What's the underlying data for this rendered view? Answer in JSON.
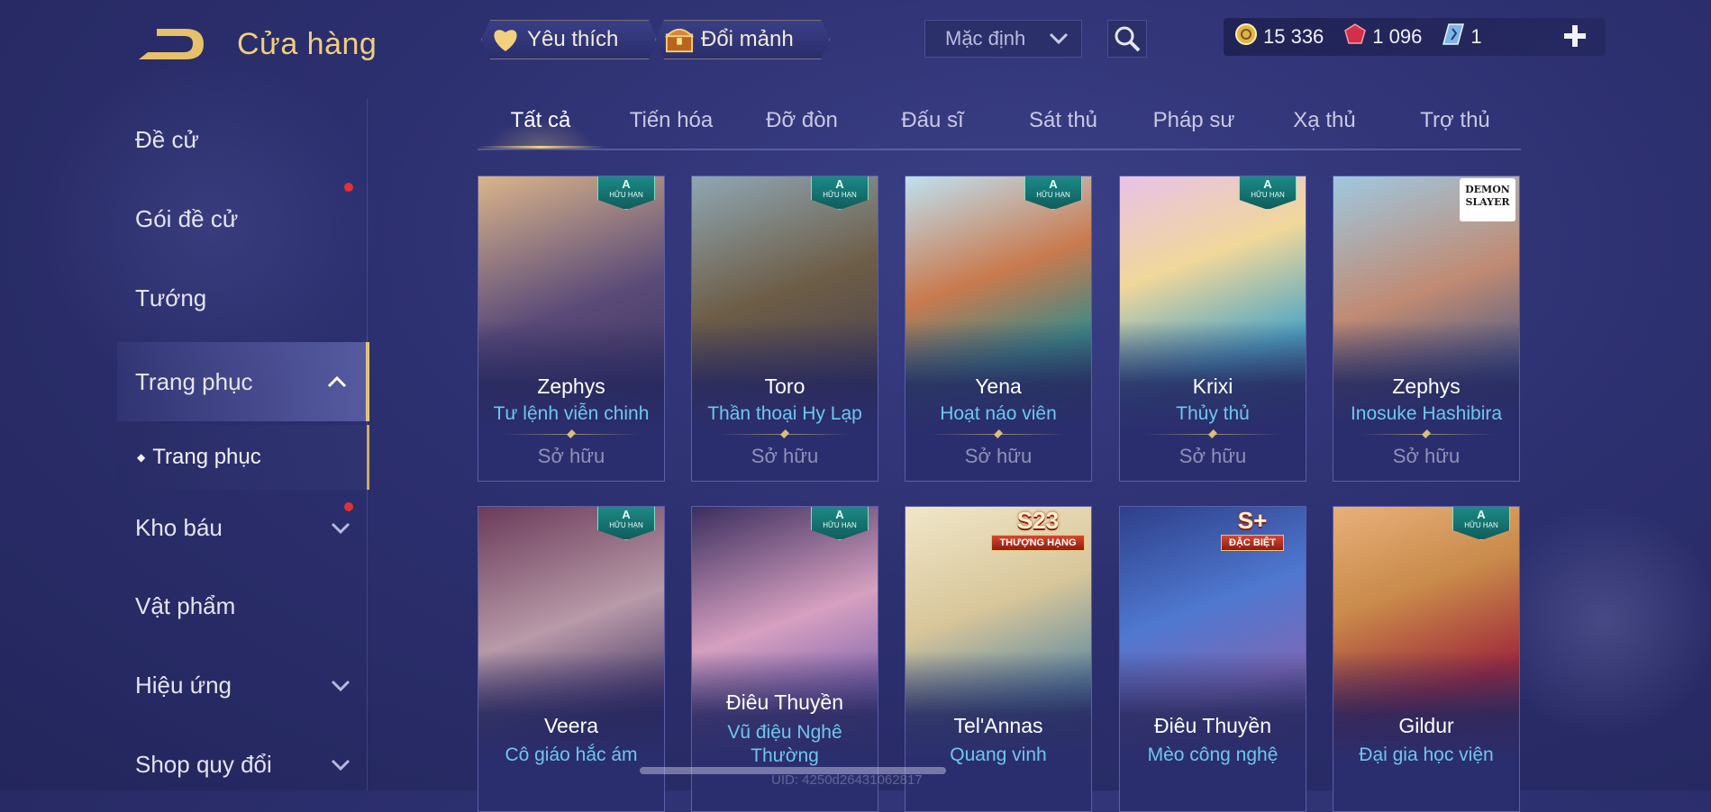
{
  "header": {
    "title": "Cửa hàng",
    "favorite_label": "Yêu thích",
    "exchange_label": "Đổi mảnh",
    "sort_select_value": "Mặc định"
  },
  "currency": {
    "gold": "15 336",
    "rubies": "1 096",
    "vouchers": "1"
  },
  "sidebar": {
    "items": [
      {
        "label": "Đề cử"
      },
      {
        "label": "Gói đề cử"
      },
      {
        "label": "Tướng"
      },
      {
        "label": "Trang phục"
      },
      {
        "label": "Kho báu"
      },
      {
        "label": "Vật phẩm"
      },
      {
        "label": "Hiệu ứng"
      },
      {
        "label": "Shop quy đổi"
      }
    ],
    "sub_item": "Trang phục"
  },
  "tabs": [
    "Tất cả",
    "Tiến hóa",
    "Đỡ đòn",
    "Đấu sĩ",
    "Sát thủ",
    "Pháp sư",
    "Xạ thủ",
    "Trợ thủ"
  ],
  "cards": [
    {
      "hero": "Zephys",
      "skin": "Tư lệnh viễn chinh",
      "status": "Sở hữu",
      "tag": "A",
      "tag_sub": "HỮU HẠN"
    },
    {
      "hero": "Toro",
      "skin": "Thần thoại Hy Lạp",
      "status": "Sở hữu",
      "tag": "A",
      "tag_sub": "HỮU HẠN"
    },
    {
      "hero": "Yena",
      "skin": "Hoạt náo viên",
      "status": "Sở hữu",
      "tag": "A",
      "tag_sub": "HỮU HẠN"
    },
    {
      "hero": "Krixi",
      "skin": "Thủy thủ",
      "status": "Sở hữu",
      "tag": "A",
      "tag_sub": "HỮU HẠN"
    },
    {
      "hero": "Zephys",
      "skin": "Inosuke Hashibira",
      "status": "Sở hữu",
      "tag": "DEMON SLAYER",
      "tag_sub": ""
    },
    {
      "hero": "Veera",
      "skin": "Cô giáo hắc ám",
      "status": "",
      "tag": "A",
      "tag_sub": "HỮU HẠN"
    },
    {
      "hero": "Điêu Thuyền",
      "skin": "Vũ điệu Nghê Thường",
      "status": "",
      "tag": "A",
      "tag_sub": "HỮU HẠN"
    },
    {
      "hero": "Tel'Annas",
      "skin": "Quang vinh",
      "status": "",
      "tag": "S23",
      "tag_sub": "THƯỢNG HẠNG"
    },
    {
      "hero": "Điêu Thuyền",
      "skin": "Mèo công nghệ",
      "status": "",
      "tag": "S+",
      "tag_sub": "ĐẶC BIỆT"
    },
    {
      "hero": "Gildur",
      "skin": "Đại gia học viện",
      "status": "",
      "tag": "A",
      "tag_sub": "HỮU HẠN"
    }
  ],
  "footer": {
    "uid": "UID: 4250d26431062817"
  },
  "colors": {
    "accent_gold": "#f0cf7c",
    "skin_name": "#6fc6f0",
    "background": "#2d3070"
  }
}
